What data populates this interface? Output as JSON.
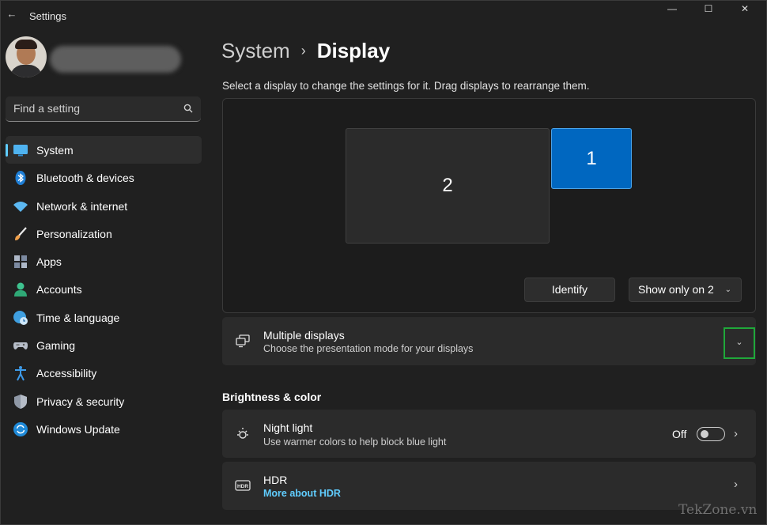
{
  "app": {
    "title": "Settings"
  },
  "window_controls": {
    "minimize": "—",
    "maximize": "☐",
    "close": "✕"
  },
  "search": {
    "placeholder": "Find a setting"
  },
  "nav": {
    "items": [
      {
        "label": "System",
        "icon": "monitor-icon",
        "active": true
      },
      {
        "label": "Bluetooth & devices",
        "icon": "bluetooth-icon"
      },
      {
        "label": "Network & internet",
        "icon": "wifi-icon"
      },
      {
        "label": "Personalization",
        "icon": "brush-icon"
      },
      {
        "label": "Apps",
        "icon": "apps-icon"
      },
      {
        "label": "Accounts",
        "icon": "person-icon"
      },
      {
        "label": "Time & language",
        "icon": "globe-clock-icon"
      },
      {
        "label": "Gaming",
        "icon": "gamepad-icon"
      },
      {
        "label": "Accessibility",
        "icon": "accessibility-icon"
      },
      {
        "label": "Privacy & security",
        "icon": "shield-icon"
      },
      {
        "label": "Windows Update",
        "icon": "update-icon"
      }
    ]
  },
  "breadcrumb": {
    "parent": "System",
    "separator": "›",
    "current": "Display"
  },
  "hint": "Select a display to change the settings for it. Drag displays to rearrange them.",
  "displays": {
    "monitor_2": "2",
    "monitor_1": "1",
    "identify_label": "Identify",
    "show_only_value": "Show only on 2"
  },
  "multiple_displays": {
    "title": "Multiple displays",
    "subtitle": "Choose the presentation mode for your displays"
  },
  "brightness_section": {
    "heading": "Brightness & color"
  },
  "night_light": {
    "title": "Night light",
    "subtitle": "Use warmer colors to help block blue light",
    "state_label": "Off"
  },
  "hdr": {
    "icon_text": "HDR",
    "title": "HDR",
    "link": "More about HDR"
  },
  "watermark": "TekZone.vn",
  "colors": {
    "accent": "#60cdff",
    "selected_display": "#0067c0",
    "highlight_box": "#1fa83a"
  }
}
